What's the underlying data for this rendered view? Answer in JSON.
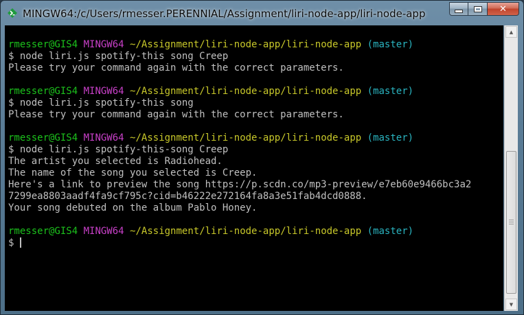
{
  "window": {
    "title": "MINGW64:/c/Users/rmesser.PERENNIAL/Assignment/liri-node-app/liri-node-app",
    "icon": "git-bash-icon",
    "controls": {
      "minimize": "minimize-icon",
      "maximize": "maximize-icon",
      "close": "close-icon",
      "close_glyph": "✕"
    }
  },
  "colors": {
    "user": "#1cc21c",
    "env": "#c840c8",
    "path": "#c8c82a",
    "branch": "#2ab4c0",
    "text": "#c0c0c0",
    "background": "#000000"
  },
  "terminal": {
    "lines": [
      {
        "user": "rmesser@GIS4",
        "env": "MINGW64",
        "path": "~/Assignment/liri-node-app/liri-node-app",
        "branch": "(master)"
      },
      {
        "text": "$ node liri.js spotify-this song Creep"
      },
      {
        "text": "Please try your command again with the correct parameters."
      },
      {
        "text": ""
      },
      {
        "user": "rmesser@GIS4",
        "env": "MINGW64",
        "path": "~/Assignment/liri-node-app/liri-node-app",
        "branch": "(master)"
      },
      {
        "text": "$ node liri.js spotify-this song"
      },
      {
        "text": "Please try your command again with the correct parameters."
      },
      {
        "text": ""
      },
      {
        "user": "rmesser@GIS4",
        "env": "MINGW64",
        "path": "~/Assignment/liri-node-app/liri-node-app",
        "branch": "(master)"
      },
      {
        "text": "$ node liri.js spotify-this-song Creep"
      },
      {
        "text": "The artist you selected is Radiohead."
      },
      {
        "text": "The name of the song you selected is Creep."
      },
      {
        "text": "Here's a link to preview the song https://p.scdn.co/mp3-preview/e7eb60e9466bc3a2"
      },
      {
        "text": "7299ea8803aadf4fa9cf795c?cid=b46222e272164fa8a3e51fab4dcd0888."
      },
      {
        "text": "Your song debuted on the album Pablo Honey."
      },
      {
        "text": ""
      },
      {
        "user": "rmesser@GIS4",
        "env": "MINGW64",
        "path": "~/Assignment/liri-node-app/liri-node-app",
        "branch": "(master)"
      },
      {
        "text": "$",
        "cursor": true
      }
    ]
  },
  "scrollbar": {
    "up_icon": "scroll-up-arrow-icon",
    "down_icon": "scroll-down-arrow-icon",
    "up_glyph": "▲",
    "down_glyph": "▼"
  }
}
